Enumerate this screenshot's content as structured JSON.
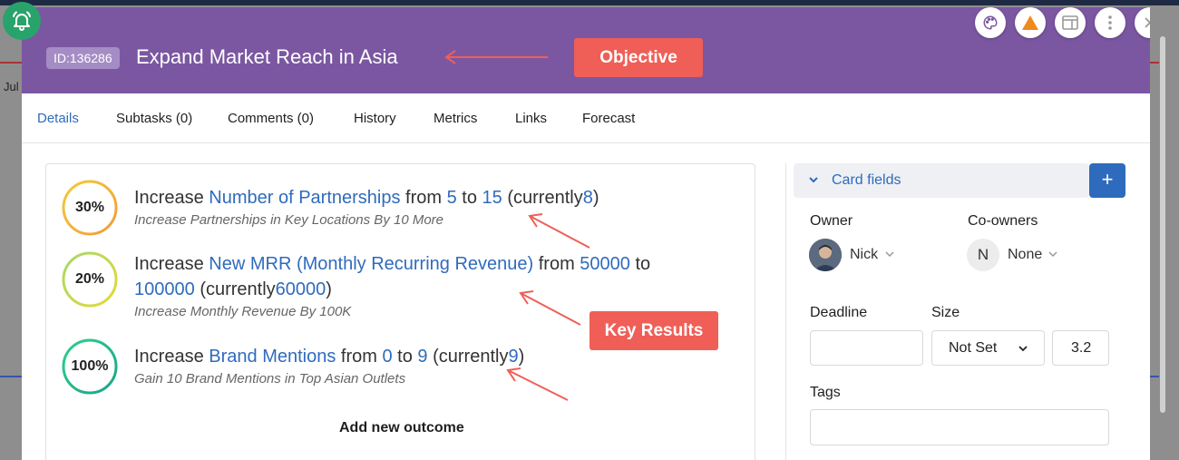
{
  "background": {
    "month_label": "Jul"
  },
  "header": {
    "id_badge": "ID:136286",
    "title": "Expand Market Reach in Asia",
    "callout": "Objective"
  },
  "header_buttons": [
    {
      "icon": "palette-icon"
    },
    {
      "icon": "warning-triangle-icon"
    },
    {
      "icon": "layout-icon"
    },
    {
      "icon": "more-vertical-icon"
    },
    {
      "icon": "close-icon"
    }
  ],
  "tabs": [
    {
      "label": "Details",
      "active": true
    },
    {
      "label": "Subtasks (0)"
    },
    {
      "label": "Comments (0)"
    },
    {
      "label": "History"
    },
    {
      "label": "Metrics"
    },
    {
      "label": "Links"
    },
    {
      "label": "Forecast"
    }
  ],
  "key_results": [
    {
      "progress": "30%",
      "progress_value": 0.3,
      "verb": "Increase",
      "metric": "Number of Partnerships",
      "from_word": "from",
      "from": "5",
      "to_word": "to",
      "to": "15",
      "currently_word": "(currently",
      "current": "8",
      "close": ")",
      "description": "Increase Partnerships in Key Locations By 10 More"
    },
    {
      "progress": "20%",
      "progress_value": 0.2,
      "verb": "Increase",
      "metric": "New MRR (Monthly Recurring Revenue)",
      "from_word": "from",
      "from": "50000",
      "to_word": "to",
      "to": "100000",
      "currently_word": "(currently",
      "current": "60000",
      "close": ")",
      "description": "Increase Monthly Revenue By 100K"
    },
    {
      "progress": "100%",
      "progress_value": 1.0,
      "verb": "Increase",
      "metric": "Brand Mentions",
      "from_word": "from",
      "from": "0",
      "to_word": "to",
      "to": "9",
      "currently_word": "(currently",
      "current": "9",
      "close": ")",
      "description": "Gain 10 Brand Mentions in Top Asian Outlets"
    }
  ],
  "key_results_callout": "Key Results",
  "add_outcome_label": "Add new outcome",
  "card_fields": {
    "title": "Card fields",
    "add_label": "+",
    "owner_label": "Owner",
    "owner_name": "Nick",
    "coowners_label": "Co-owners",
    "coowner_initial": "N",
    "coowner_value": "None",
    "deadline_label": "Deadline",
    "deadline_value": "",
    "size_label": "Size",
    "size_select": "Not Set",
    "size_value": "3.2",
    "tags_label": "Tags",
    "tags_value": ""
  },
  "colors": {
    "header_bg": "#7b57a2",
    "accent": "#2f6bbd",
    "callout": "#ef5f57",
    "bell": "#27a36b"
  }
}
